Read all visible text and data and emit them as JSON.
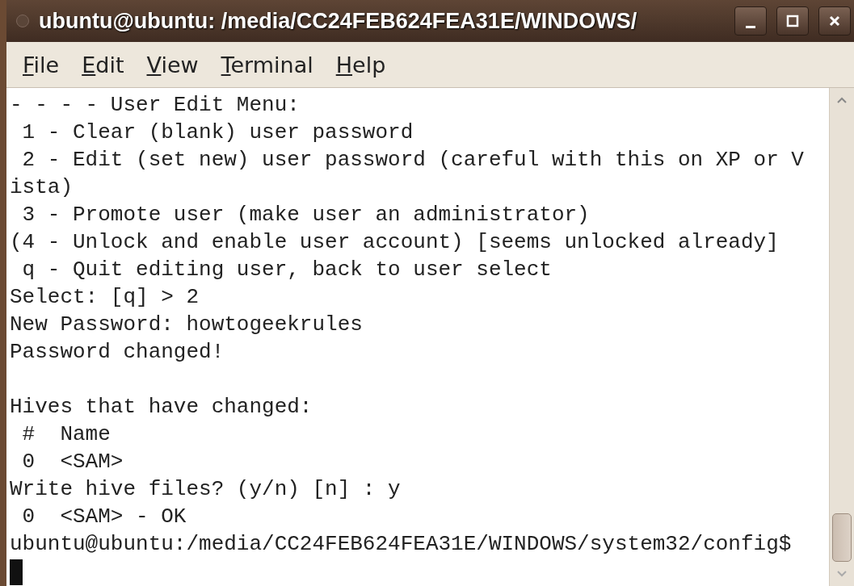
{
  "window": {
    "title": "ubuntu@ubuntu: /media/CC24FEB624FEA31E/WINDOWS/"
  },
  "menu": [
    "File",
    "Edit",
    "View",
    "Terminal",
    "Help"
  ],
  "terminal": {
    "blocks": [
      [
        "- - - - User Edit Menu:",
        " 1 - Clear (blank) user password",
        " 2 - Edit (set new) user password (careful with this on XP or V",
        "ista)",
        " 3 - Promote user (make user an administrator)",
        "(4 - Unlock and enable user account) [seems unlocked already]",
        " q - Quit editing user, back to user select",
        "Select: [q] > 2",
        "New Password: howtogeekrules",
        "Password changed!"
      ],
      [
        "Hives that have changed:",
        " #  Name",
        " 0  <SAM>",
        "Write hive files? (y/n) [n] : y",
        " 0  <SAM> - OK",
        "ubuntu@ubuntu:/media/CC24FEB624FEA31E/WINDOWS/system32/config$"
      ]
    ]
  }
}
